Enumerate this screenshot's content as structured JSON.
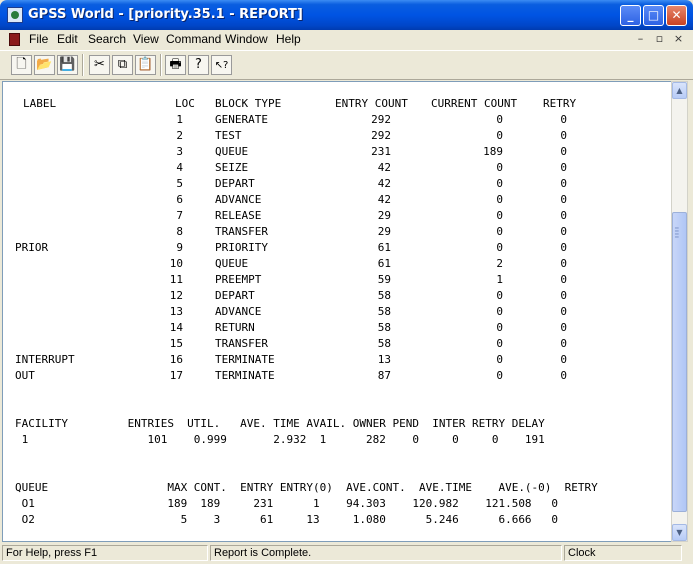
{
  "window": {
    "title": "GPSS World - [priority.35.1  -  REPORT]",
    "controls": {
      "minimize": "_",
      "maximize": "□",
      "close": "✕"
    }
  },
  "menu": [
    "File",
    "Edit",
    "Search",
    "View",
    "Command",
    "Window",
    "Help"
  ],
  "mdi_controls": [
    "–",
    "▫",
    "×"
  ],
  "toolbar": {
    "buttons": [
      {
        "name": "new-icon",
        "glyph": "🗋"
      },
      {
        "name": "open-icon",
        "glyph": "📂"
      },
      {
        "name": "save-icon",
        "glyph": "💾"
      },
      {
        "name": "cut-icon",
        "glyph": "✂"
      },
      {
        "name": "copy-icon",
        "glyph": "⧉"
      },
      {
        "name": "paste-icon",
        "glyph": "📋"
      },
      {
        "name": "print-icon",
        "glyph": "🖶"
      },
      {
        "name": "help-icon",
        "glyph": "?"
      },
      {
        "name": "context-help-icon",
        "glyph": "↖?"
      }
    ]
  },
  "report": {
    "blocks": {
      "headers": {
        "label": "LABEL",
        "loc": "LOC",
        "block_type": "BLOCK TYPE",
        "entry_count": "ENTRY COUNT",
        "current_count": "CURRENT COUNT",
        "retry": "RETRY"
      },
      "rows": [
        {
          "label": "",
          "loc": "1",
          "type": "GENERATE",
          "entry": "292",
          "current": "0",
          "retry": "0"
        },
        {
          "label": "",
          "loc": "2",
          "type": "TEST",
          "entry": "292",
          "current": "0",
          "retry": "0"
        },
        {
          "label": "",
          "loc": "3",
          "type": "QUEUE",
          "entry": "231",
          "current": "189",
          "retry": "0"
        },
        {
          "label": "",
          "loc": "4",
          "type": "SEIZE",
          "entry": "42",
          "current": "0",
          "retry": "0"
        },
        {
          "label": "",
          "loc": "5",
          "type": "DEPART",
          "entry": "42",
          "current": "0",
          "retry": "0"
        },
        {
          "label": "",
          "loc": "6",
          "type": "ADVANCE",
          "entry": "42",
          "current": "0",
          "retry": "0"
        },
        {
          "label": "",
          "loc": "7",
          "type": "RELEASE",
          "entry": "29",
          "current": "0",
          "retry": "0"
        },
        {
          "label": "",
          "loc": "8",
          "type": "TRANSFER",
          "entry": "29",
          "current": "0",
          "retry": "0"
        },
        {
          "label": "PRIOR",
          "loc": "9",
          "type": "PRIORITY",
          "entry": "61",
          "current": "0",
          "retry": "0"
        },
        {
          "label": "",
          "loc": "10",
          "type": "QUEUE",
          "entry": "61",
          "current": "2",
          "retry": "0"
        },
        {
          "label": "",
          "loc": "11",
          "type": "PREEMPT",
          "entry": "59",
          "current": "1",
          "retry": "0"
        },
        {
          "label": "",
          "loc": "12",
          "type": "DEPART",
          "entry": "58",
          "current": "0",
          "retry": "0"
        },
        {
          "label": "",
          "loc": "13",
          "type": "ADVANCE",
          "entry": "58",
          "current": "0",
          "retry": "0"
        },
        {
          "label": "",
          "loc": "14",
          "type": "RETURN",
          "entry": "58",
          "current": "0",
          "retry": "0"
        },
        {
          "label": "",
          "loc": "15",
          "type": "TRANSFER",
          "entry": "58",
          "current": "0",
          "retry": "0"
        },
        {
          "label": "INTERRUPT",
          "loc": "16",
          "type": "TERMINATE",
          "entry": "13",
          "current": "0",
          "retry": "0"
        },
        {
          "label": "OUT",
          "loc": "17",
          "type": "TERMINATE",
          "entry": "87",
          "current": "0",
          "retry": "0"
        }
      ]
    },
    "facility": {
      "header": "FACILITY         ENTRIES  UTIL.   AVE. TIME AVAIL. OWNER PEND  INTER RETRY DELAY",
      "rows": [
        " 1                  101    0.999       2.932  1      282    0     0     0    191"
      ]
    },
    "queue": {
      "header": "QUEUE                  MAX CONT.  ENTRY ENTRY(0)  AVE.CONT.  AVE.TIME    AVE.(-0)  RETRY",
      "rows": [
        " O1                    189  189     231      1    94.303    120.982    121.508   0",
        " O2                      5    3      61     13     1.080      5.246      6.666   0"
      ]
    }
  },
  "status": {
    "help": "For Help, press F1",
    "message": "Report is Complete.",
    "clock": "Clock"
  }
}
